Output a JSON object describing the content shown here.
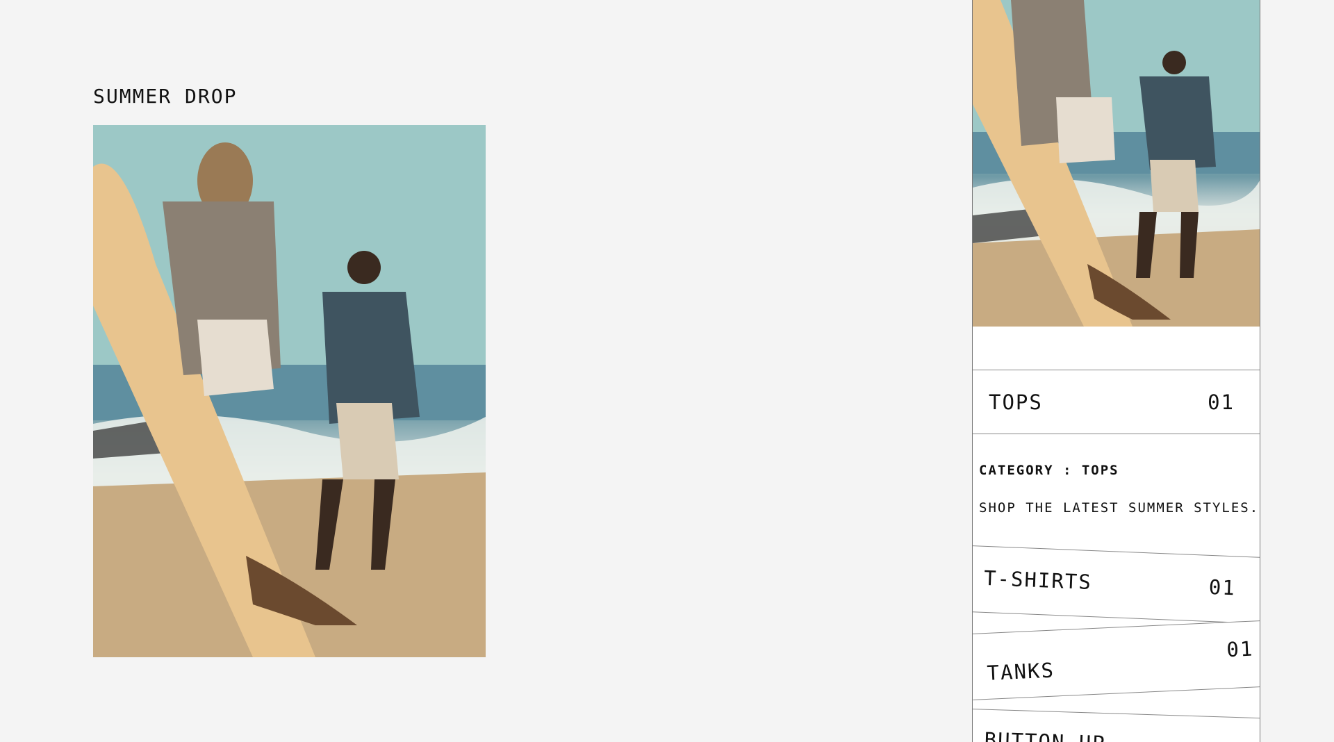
{
  "collection": {
    "title": "SUMMER DROP"
  },
  "panel": {
    "active_category": {
      "label": "TOPS",
      "count": "01"
    },
    "category_line": "CATEGORY : TOPS",
    "description": "SHOP THE LATEST SUMMER STYLES.",
    "subcategories": [
      {
        "label": "T-SHIRTS",
        "count": "01"
      },
      {
        "label": "TANKS",
        "count": "01"
      },
      {
        "label": "BUTTON-UP"
      }
    ]
  },
  "colors": {
    "background": "#f4f4f4",
    "panel": "#ffffff",
    "rule": "#888888",
    "text": "#111111"
  }
}
